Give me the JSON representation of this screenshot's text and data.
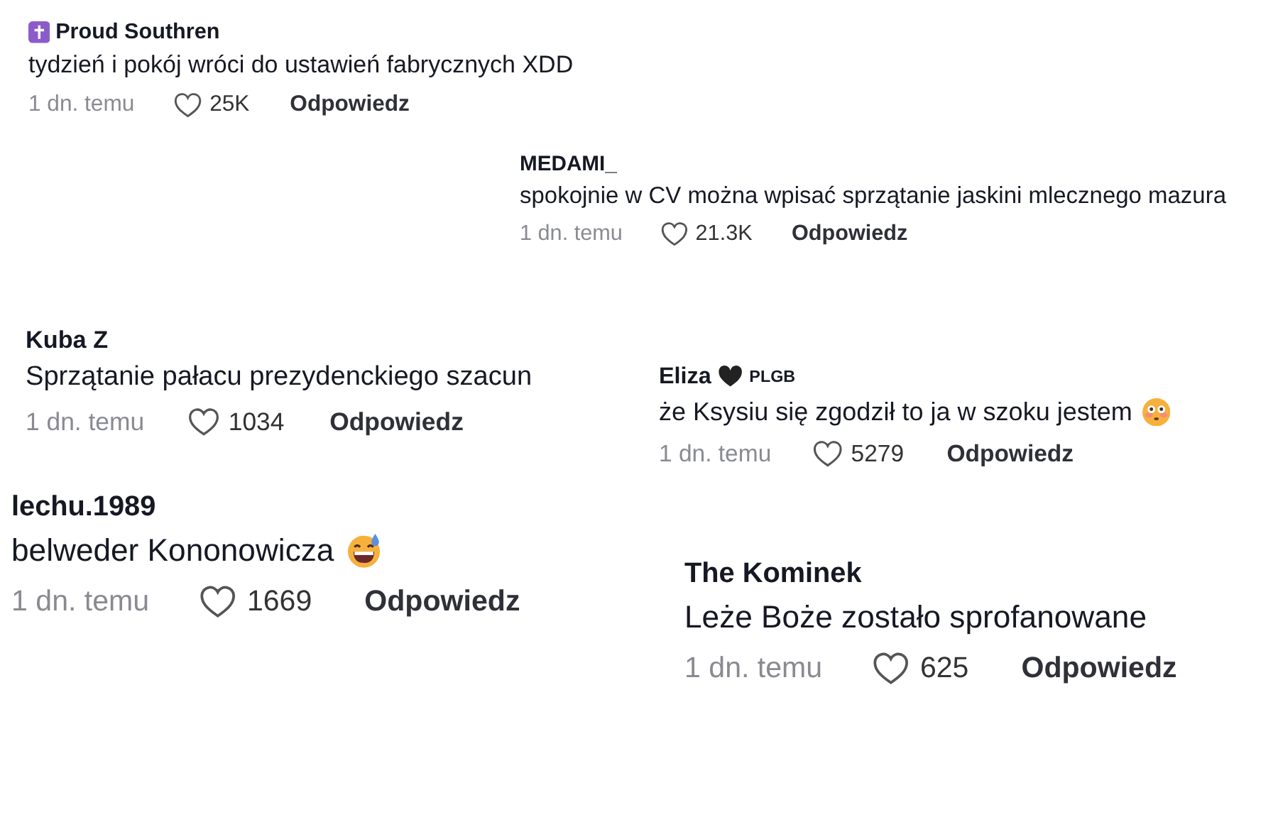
{
  "comments": [
    {
      "kind": "cross-badge",
      "author": "Proud Southren",
      "text": "tydzień i pokój wróci do ustawień fabrycznych XDD",
      "time": "1 dn. temu",
      "likes": "25K",
      "reply": "Odpowiedz"
    },
    {
      "kind": "plain",
      "author": "MEDAMI_",
      "text": "spokojnie w CV można wpisać sprzątanie jaskini mlecznego mazura",
      "time": "1 dn. temu",
      "likes": "21.3K",
      "reply": "Odpowiedz"
    },
    {
      "kind": "plain",
      "author": "Kuba Z",
      "text": "Sprzątanie pałacu prezydenckiego szacun",
      "time": "1 dn. temu",
      "likes": "1034",
      "reply": "Odpowiedz"
    },
    {
      "kind": "heart-badge",
      "author": "Eliza",
      "author_tag": "PLGB",
      "text": "że Ksysiu się zgodził to ja w szoku jestem",
      "emoji": {
        "kind": "flushed"
      },
      "time": "1 dn. temu",
      "likes": "5279",
      "reply": "Odpowiedz"
    },
    {
      "kind": "plain",
      "author": "lechu.1989",
      "text": "belweder Kononowicza",
      "emoji": {
        "kind": "sweat-smile"
      },
      "time": "1 dn. temu",
      "likes": "1669",
      "reply": "Odpowiedz"
    },
    {
      "kind": "plain",
      "author": "The Kominek",
      "text": "Leże Boże zostało sprofanowane",
      "time": "1 dn. temu",
      "likes": "625",
      "reply": "Odpowiedz"
    }
  ]
}
